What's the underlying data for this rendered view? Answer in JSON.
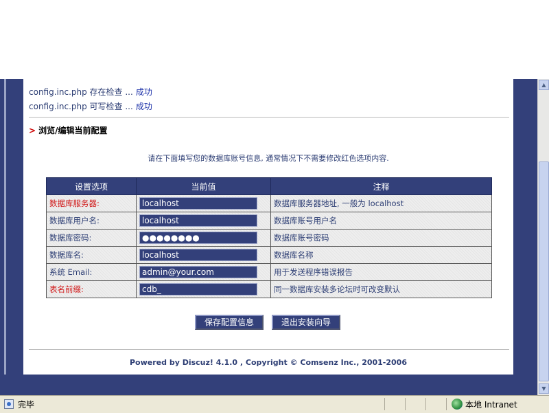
{
  "sections": {
    "checks": [
      {
        "text": "config.inc.php 存在检查 ...",
        "result": "成功"
      },
      {
        "text": "config.inc.php 可写检查 ...",
        "result": "成功"
      }
    ],
    "edit_title": "浏览/编辑当前配置",
    "arrow": ">"
  },
  "intro": "请在下面填写您的数据库账号信息, 通常情况下不需要修改红色选项内容.",
  "table": {
    "headers": [
      "设置选项",
      "当前值",
      "注释"
    ],
    "rows": [
      {
        "label": "数据库服务器:",
        "value": "localhost",
        "note": "数据库服务器地址, 一般为 localhost",
        "red": true
      },
      {
        "label": "数据库用户名:",
        "value": "localhost",
        "note": "数据库账号用户名",
        "red": false
      },
      {
        "label": "数据库密码:",
        "value": "●●●●●●●●",
        "note": "数据库账号密码",
        "red": false
      },
      {
        "label": "数据库名:",
        "value": "localhost",
        "note": "数据库名称",
        "red": false
      },
      {
        "label": "系统 Email:",
        "value": "admin@your.com",
        "note": "用于发送程序错误报告",
        "red": false
      },
      {
        "label": "表名前缀:",
        "value": "cdb_",
        "note": "同一数据库安装多论坛时可改变默认",
        "red": true
      }
    ]
  },
  "buttons": {
    "save": "保存配置信息",
    "exit": "退出安装向导"
  },
  "footer": "Powered by Discuz! 4.1.0 ,  Copyright © Comsenz Inc., 2001-2006",
  "statusbar": {
    "status": "完毕",
    "zone": "本地 Intranet"
  },
  "colors": {
    "frame": "#33407a",
    "required_label": "#d11a1a",
    "link_ok": "#1a2fa8"
  }
}
